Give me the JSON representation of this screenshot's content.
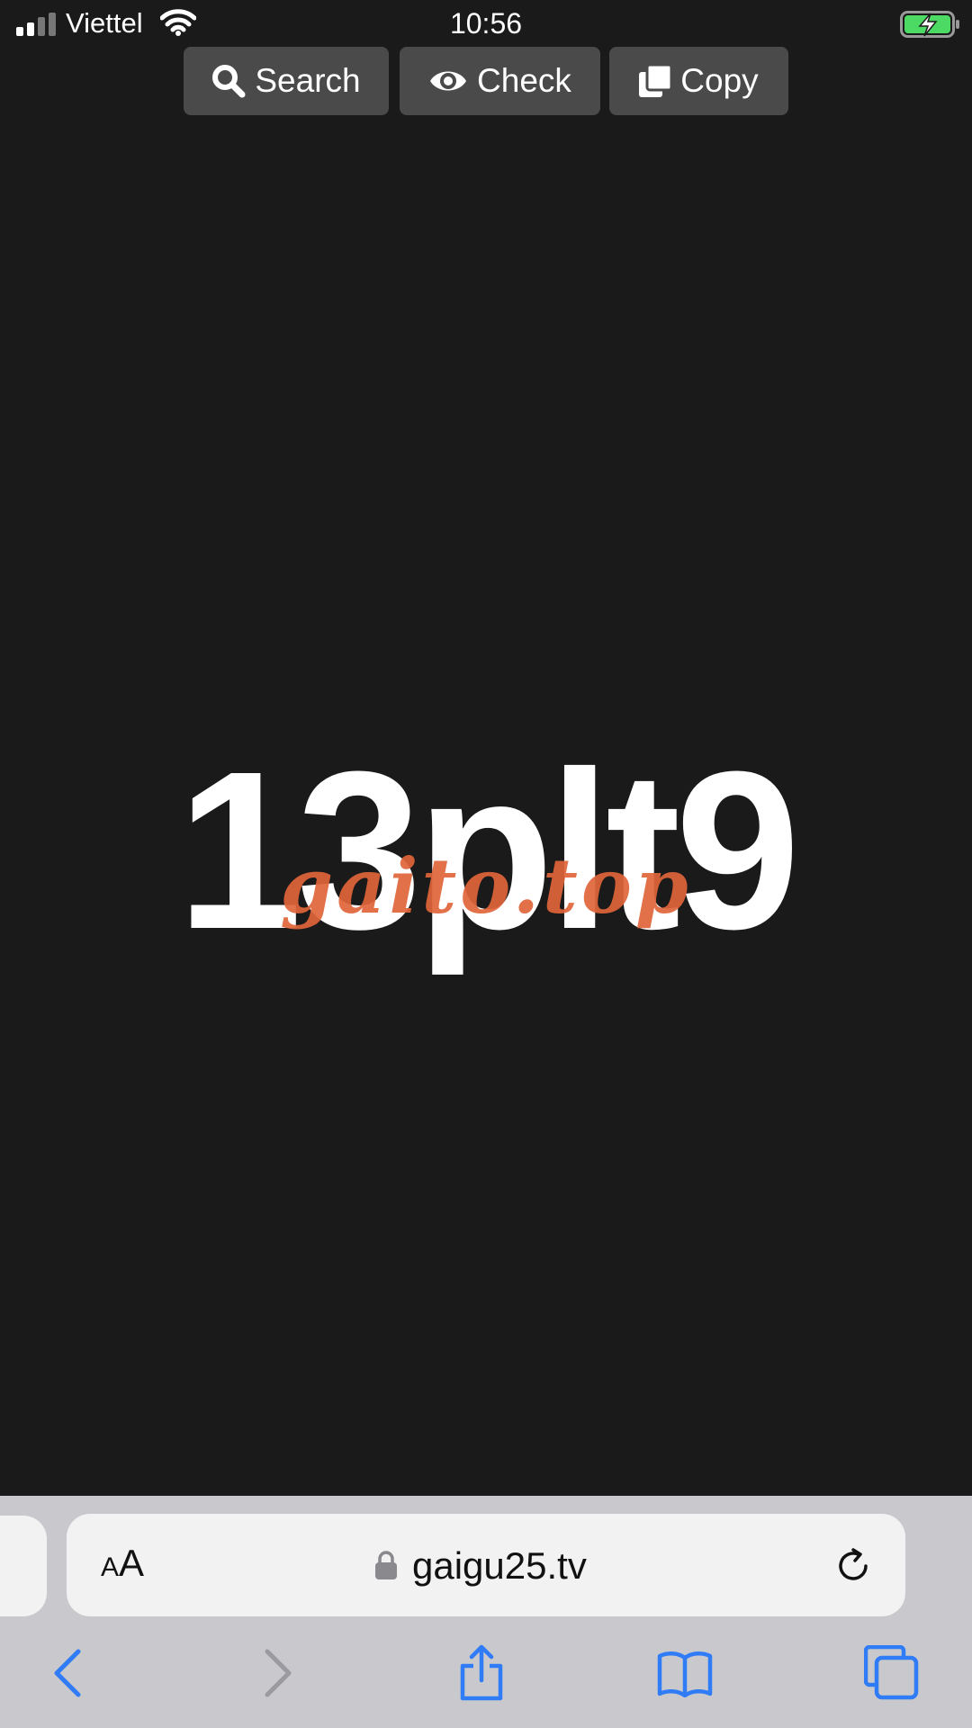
{
  "status_bar": {
    "carrier": "Viettel",
    "time": "10:56",
    "accent_battery": "#4cd964"
  },
  "toolbar": {
    "search_label": "Search",
    "check_label": "Check",
    "copy_label": "Copy",
    "button_bg": "#4a4a4a"
  },
  "main": {
    "code": "13plt9",
    "watermark": "gaito.top",
    "watermark_color": "#e0643a"
  },
  "browser": {
    "text_size_small": "A",
    "text_size_big": "A",
    "url": "gaigu25.tv",
    "accent": "#2f7cf6",
    "icons": [
      "lock-icon",
      "reload-icon",
      "back-icon",
      "forward-icon",
      "share-icon",
      "bookmarks-icon",
      "tabs-icon"
    ]
  }
}
